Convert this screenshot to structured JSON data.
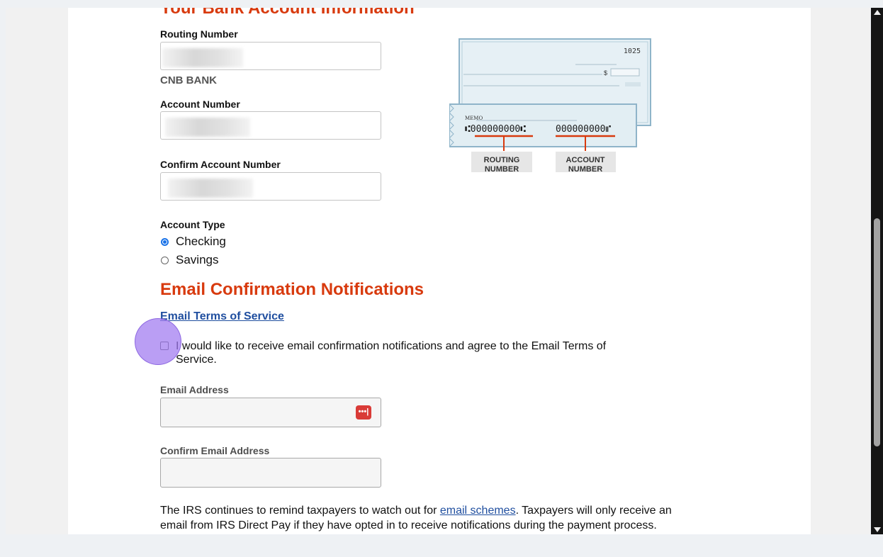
{
  "bank_section": {
    "heading": "Your Bank Account Information",
    "routing_label": "Routing Number",
    "bank_name": "CNB BANK",
    "account_label": "Account Number",
    "confirm_account_label": "Confirm Account Number",
    "account_type_label": "Account Type",
    "account_types": [
      {
        "label": "Checking",
        "selected": true
      },
      {
        "label": "Savings",
        "selected": false
      }
    ]
  },
  "check_image": {
    "check_number": "1025",
    "memo": "MEMO",
    "routing_digits": "⑆000000000⑆",
    "account_digits": "000000000⑈",
    "routing_caption_1": "ROUTING",
    "routing_caption_2": "NUMBER",
    "account_caption_1": "ACCOUNT",
    "account_caption_2": "NUMBER",
    "dollar_sign": "$"
  },
  "email_section": {
    "heading": "Email Confirmation Notifications",
    "terms_link": "Email Terms of Service",
    "opt_in_line1": "I would like to receive email confirmation notifications and agree to the Email Terms of",
    "opt_in_line2": "Service.",
    "email_label": "Email Address",
    "confirm_email_label": "Confirm Email Address",
    "password_manager_icon": "•••|"
  },
  "notice": {
    "text_before_link": "The IRS continues to remind taxpayers to watch out for ",
    "link_text": "email schemes",
    "text_after_link": ". Taxpayers will only receive an",
    "line2": "email from IRS Direct Pay if they have opted in to receive notifications during the payment process."
  },
  "colors": {
    "heading": "#d83a0e",
    "link": "#1f4e9f",
    "radio_selected": "#1a73e8",
    "click_indicator": "#a078f0"
  }
}
